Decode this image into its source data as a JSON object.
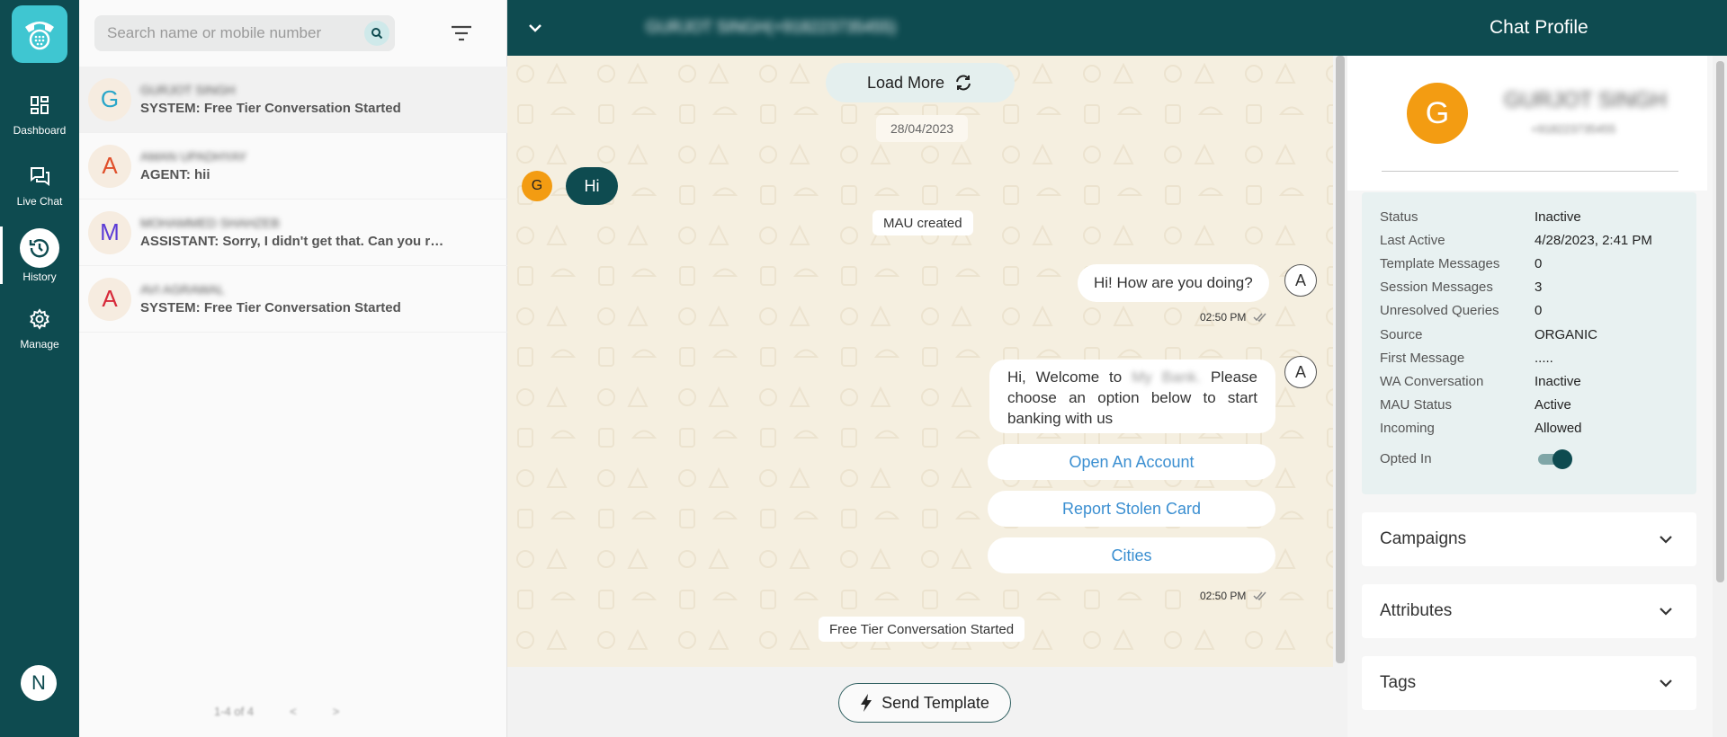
{
  "nav": {
    "items": [
      {
        "label": "Dashboard",
        "icon": "dashboard-icon"
      },
      {
        "label": "Live Chat",
        "icon": "chat-icon"
      },
      {
        "label": "History",
        "icon": "history-icon"
      },
      {
        "label": "Manage",
        "icon": "gear-icon"
      }
    ],
    "user_initial": "N"
  },
  "search": {
    "placeholder": "Search name or mobile number"
  },
  "contacts": [
    {
      "initial": "G",
      "initial_color": "#2aa6c9",
      "name": "GURJOT SINGH",
      "message": "SYSTEM: Free Tier Conversation Started"
    },
    {
      "initial": "A",
      "initial_color": "#e0502b",
      "name": "AMAN UPADHYAY",
      "message": "AGENT: hii"
    },
    {
      "initial": "M",
      "initial_color": "#5b3bd6",
      "name": "MOHAMMED SHAHZEB",
      "message": "ASSISTANT: Sorry, I didn't get that. Can you rephrase..."
    },
    {
      "initial": "A",
      "initial_color": "#d72a3a",
      "name": "AVI AGRAWAL",
      "message": "SYSTEM: Free Tier Conversation Started"
    }
  ],
  "pager": {
    "range": "1-4 of 4",
    "prev": "<",
    "next": ">"
  },
  "header": {
    "chat_title": "GURJOT SINGH(+918223735455)",
    "profile_title": "Chat Profile"
  },
  "chat": {
    "load_more": "Load More",
    "date": "28/04/2023",
    "contact_initial": "G",
    "incoming_message": "Hi",
    "mau_created": "MAU created",
    "agent_initial": "A",
    "outgoing_message": "Hi! How are you doing?",
    "outgoing_time": "02:50 PM",
    "welcome_prefix": "Hi, Welcome to",
    "welcome_bank": "My Bank.",
    "welcome_suffix": "Please choose an option below to start banking with us",
    "quick_replies": [
      "Open An Account",
      "Report Stolen Card",
      "Cities"
    ],
    "welcome_time": "02:50 PM",
    "free_tier": "Free Tier Conversation Started"
  },
  "composer": {
    "send_template": "Send Template"
  },
  "profile": {
    "initial": "G",
    "name": "GURJOT SINGH",
    "phone": "+918223735455",
    "details": [
      {
        "key": "Status",
        "value": "Inactive"
      },
      {
        "key": "Last Active",
        "value": "4/28/2023, 2:41 PM"
      },
      {
        "key": "Template Messages",
        "value": "0"
      },
      {
        "key": "Session Messages",
        "value": "3"
      },
      {
        "key": "Unresolved Queries",
        "value": "0"
      },
      {
        "key": "Source",
        "value": "ORGANIC"
      },
      {
        "key": "First Message",
        "value": "....."
      },
      {
        "key": "WA Conversation",
        "value": "Inactive"
      },
      {
        "key": "MAU Status",
        "value": "Active"
      },
      {
        "key": "Incoming",
        "value": "Allowed"
      }
    ],
    "opted_in_label": "Opted In",
    "opted_in": true,
    "sections": [
      "Campaigns",
      "Attributes",
      "Tags"
    ]
  },
  "colors": {
    "primary": "#0e4b50",
    "accent": "#3fc6d1",
    "chat_bg": "#f5efe0",
    "avatar_orange": "#f39c12",
    "link_blue": "#3b8fd1"
  }
}
